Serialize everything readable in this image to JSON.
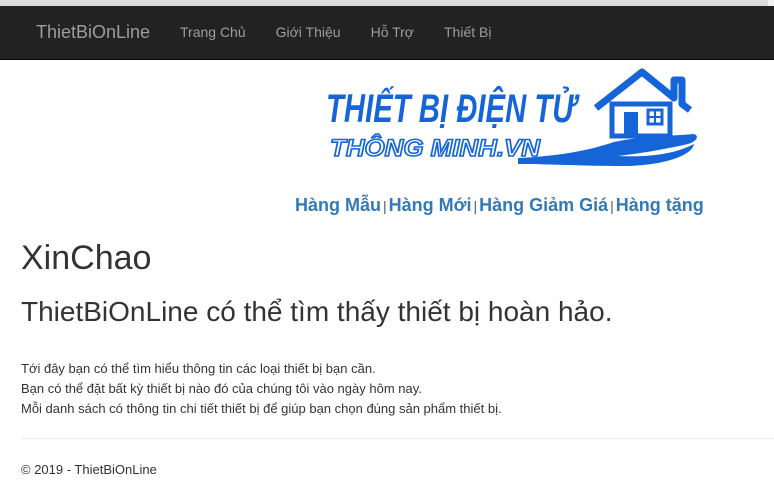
{
  "navbar": {
    "brand": "ThietBiOnLine",
    "links": [
      {
        "label": "Trang Chủ"
      },
      {
        "label": "Giới Thiệu"
      },
      {
        "label": "Hỗ Trợ"
      },
      {
        "label": "Thiết Bị"
      }
    ]
  },
  "logo": {
    "line1": "THIẾT BỊ ĐIỆN TỬ",
    "line2": "THÔNG MINH.VN",
    "color": "#1565d8",
    "icon": "house-in-hand-icon"
  },
  "categories": [
    {
      "label": "Hàng Mẫu"
    },
    {
      "label": "Hàng Mới"
    },
    {
      "label": "Hàng Giảm Giá"
    },
    {
      "label": "Hàng tặng"
    }
  ],
  "category_separator": "|",
  "main": {
    "heading": "XinChao",
    "subheading": "ThietBiOnLine có thể tìm thấy thiết bị hoàn hảo.",
    "paragraphs": [
      "Tới đây bạn có thể tìm hiểu thông tin các loại thiết bị bạn cần.",
      "Bạn có thể đặt bất kỳ thiết bị nào đó của chúng tôi vào ngày hôm nay.",
      "Mỗi danh sách có thông tin chi tiết thiết bị để giúp bạn chọn đúng sản phẩm thiết bị."
    ]
  },
  "footer": {
    "text": "© 2019 - ThietBiOnLine"
  }
}
